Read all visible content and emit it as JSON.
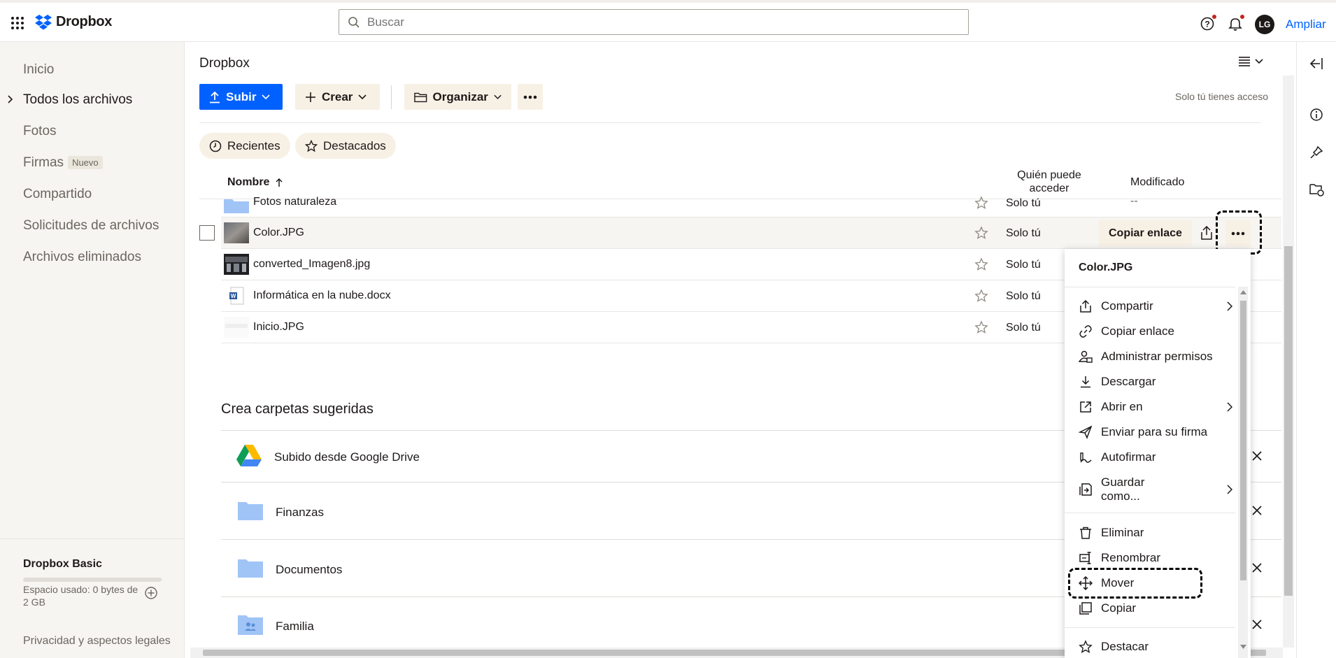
{
  "topbar": {
    "logo": "Dropbox",
    "search_placeholder": "Buscar",
    "avatar_initials": "LG",
    "upgrade": "Ampliar"
  },
  "sidebar": {
    "items": [
      {
        "label": "Inicio"
      },
      {
        "label": "Todos los archivos"
      },
      {
        "label": "Fotos"
      },
      {
        "label": "Firmas",
        "badge": "Nuevo"
      },
      {
        "label": "Compartido"
      },
      {
        "label": "Solicitudes de archivos"
      },
      {
        "label": "Archivos eliminados"
      }
    ],
    "plan": "Dropbox Basic",
    "storage_text": "Espacio usado: 0 bytes de 2 GB",
    "storage_used_fraction": 0,
    "privacy": "Privacidad y aspectos legales"
  },
  "main": {
    "breadcrumb": "Dropbox",
    "toolbar": {
      "upload": "Subir",
      "create": "Crear",
      "organize": "Organizar"
    },
    "access_note": "Solo tú tienes acceso",
    "chips": [
      "Recientes",
      "Destacados"
    ],
    "columns": {
      "name": "Nombre",
      "access": "Quién puede acceder",
      "modified": "Modificado"
    },
    "rows": [
      {
        "name": "Fotos naturaleza",
        "access": "Solo tú",
        "modified": "--",
        "type": "folder"
      },
      {
        "name": "Color.JPG",
        "access": "Solo tú",
        "modified": "",
        "type": "image"
      },
      {
        "name": "converted_Imagen8.jpg",
        "access": "Solo tú",
        "modified": "",
        "type": "image"
      },
      {
        "name": "Informática en la nube.docx",
        "access": "Solo tú",
        "modified": "",
        "type": "docx"
      },
      {
        "name": "Inicio.JPG",
        "access": "Solo tú",
        "modified": "",
        "type": "image"
      }
    ],
    "copy_link": "Copiar enlace",
    "suggested_title": "Crea carpetas sugeridas",
    "suggested": [
      {
        "name": "Subido desde Google Drive"
      },
      {
        "name": "Finanzas"
      },
      {
        "name": "Documentos"
      },
      {
        "name": "Familia"
      }
    ]
  },
  "menu": {
    "title": "Color.JPG",
    "items": [
      {
        "label": "Compartir",
        "icon": "share-icon"
      },
      {
        "label": "Copiar enlace",
        "icon": "link-icon"
      },
      {
        "label": "Administrar permisos",
        "icon": "permissions-icon"
      },
      {
        "label": "Descargar",
        "icon": "download-icon"
      },
      {
        "label": "Abrir en",
        "icon": "open-external-icon"
      },
      {
        "label": "Enviar para su firma",
        "icon": "send-icon"
      },
      {
        "label": "Autofirmar",
        "icon": "signature-icon"
      },
      {
        "label": "Guardar como...",
        "line1": "Guardar",
        "line2": "como...",
        "icon": "save-as-icon"
      },
      {
        "label": "Eliminar",
        "icon": "trash-icon"
      },
      {
        "label": "Renombrar",
        "icon": "rename-icon"
      },
      {
        "label": "Mover",
        "icon": "move-icon"
      },
      {
        "label": "Copiar",
        "icon": "copy-icon"
      },
      {
        "label": "Destacar",
        "icon": "star-icon"
      }
    ]
  },
  "colors": {
    "accent": "#0061fe",
    "secondary_button": "#f7f0e5",
    "sidebar_bg": "#f7f5f2",
    "folder": "#a1c4f6"
  }
}
